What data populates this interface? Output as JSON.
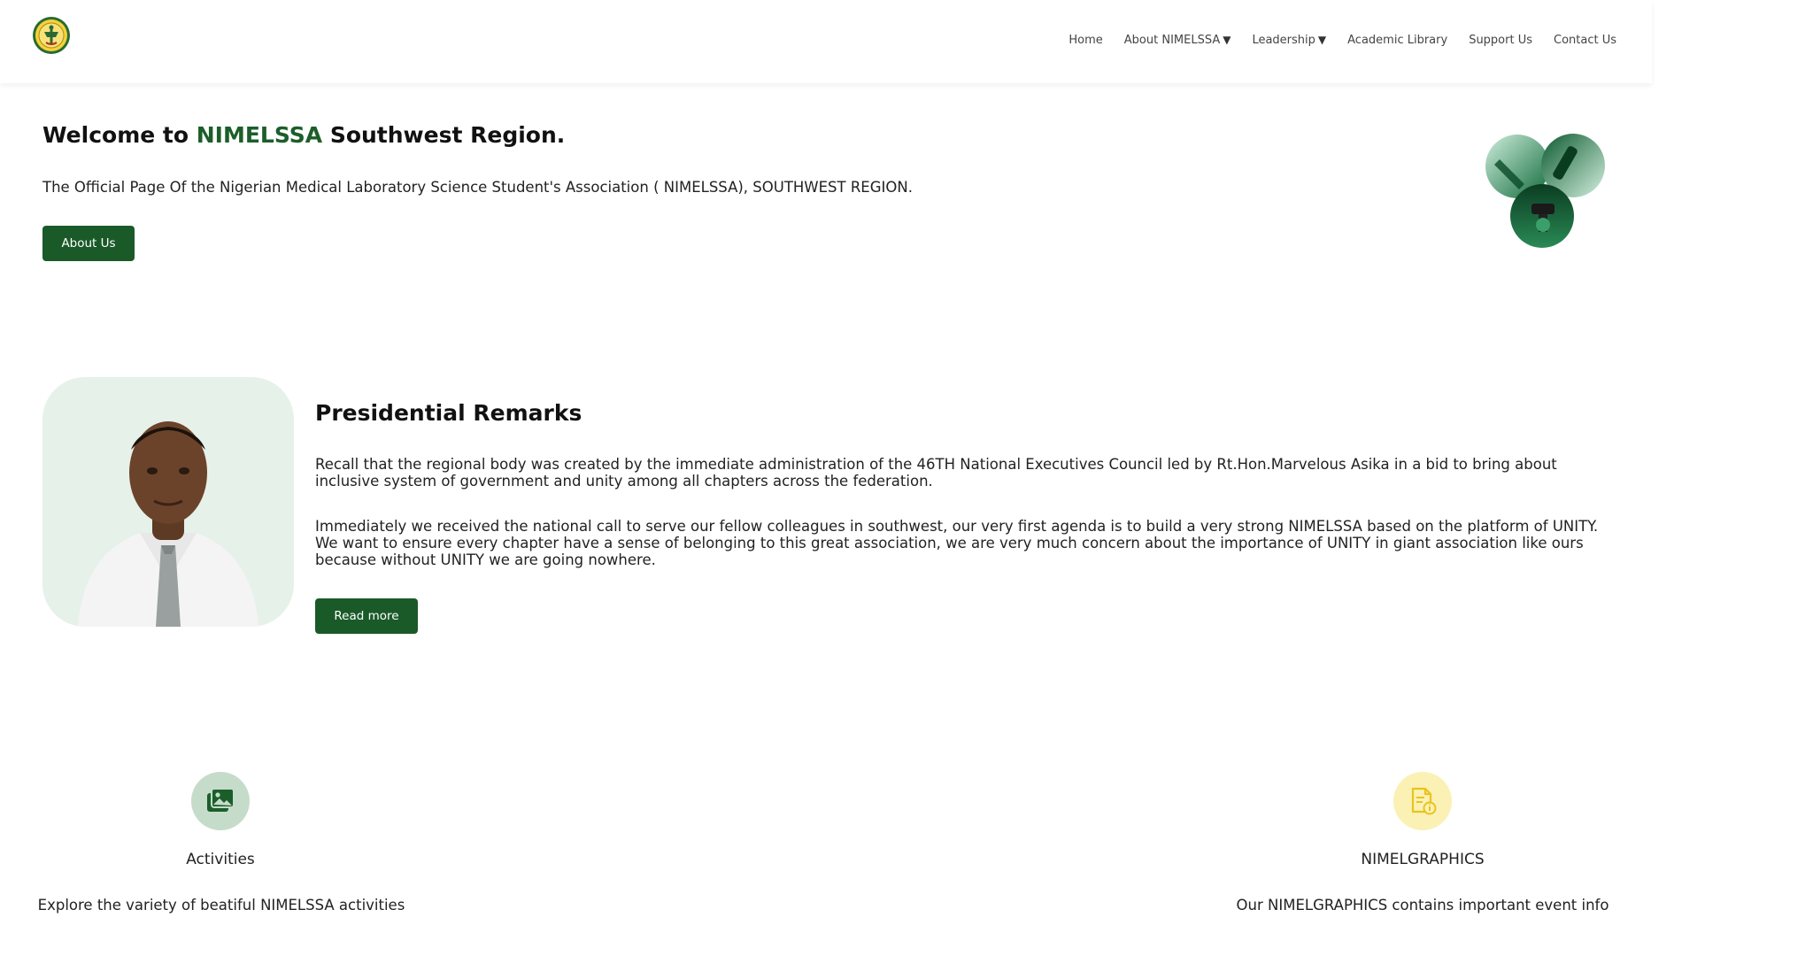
{
  "header": {
    "logo_icon": "nimelssa-logo-icon",
    "nav": [
      {
        "label": "Home",
        "has_dropdown": false
      },
      {
        "label": "About NIMELSSA",
        "has_dropdown": true
      },
      {
        "label": "Leadership",
        "has_dropdown": true
      },
      {
        "label": "Academic Library",
        "has_dropdown": false
      },
      {
        "label": "Support Us",
        "has_dropdown": false
      },
      {
        "label": "Contact Us",
        "has_dropdown": false
      }
    ],
    "caret": "▼"
  },
  "hero": {
    "title_prefix": "Welcome to ",
    "title_accent": "NIMELSSA",
    "title_suffix": " Southwest Region.",
    "subtitle": "The Official Page Of the Nigerian Medical Laboratory Science Student's Association ( NIMELSSA), SOUTHWEST REGION.",
    "button_label": "About Us",
    "graphic_icon": "microscope-collage-icon"
  },
  "president": {
    "title": "Presidential Remarks",
    "paragraph1": "Recall that the regional body was created by the immediate administration of the 46TH National Executives Council led by Rt.Hon.Marvelous Asika in a bid to bring about inclusive system of government and unity among all chapters across the federation.",
    "paragraph2": "Immediately we received the national call to serve our fellow colleagues in southwest, our very first agenda is to build a very strong NIMELSSA based on the platform of UNITY. We want to ensure every chapter have a sense of belonging to this great association, we are very much concern about the importance of UNITY in giant association like ours because without UNITY we are going nowhere.",
    "button_label": "Read more"
  },
  "features": [
    {
      "icon": "images-icon",
      "title": "Activities",
      "description": "Explore the variety of beatiful NIMELSSA activities"
    },
    {
      "icon": "document-info-icon",
      "title": "NIMELGRAPHICS",
      "description": "Our NIMELGRAPHICS contains important event info"
    }
  ],
  "colors": {
    "brand_green": "#1a5a28",
    "accent_green": "#1c5e2a",
    "activities_icon_bg": "#c6dccb",
    "graphics_icon_bg": "#fbf1b5"
  }
}
